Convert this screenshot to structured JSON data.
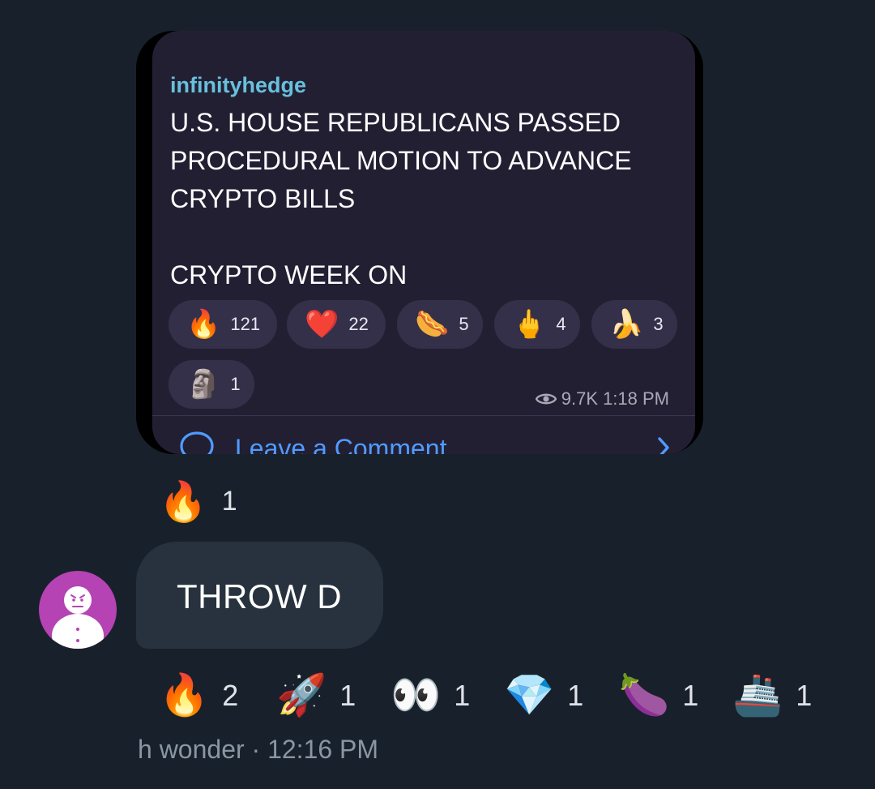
{
  "card": {
    "channel": "infinityhedge",
    "lines": [
      "U.S. HOUSE REPUBLICANS PASSED",
      "PROCEDURAL MOTION TO ADVANCE",
      "CRYPTO BILLS",
      "",
      "CRYPTO WEEK ON"
    ],
    "reactions": [
      {
        "emoji": "🔥",
        "count": "121"
      },
      {
        "emoji": "❤️",
        "count": "22"
      },
      {
        "emoji": "🌭",
        "count": "5"
      },
      {
        "emoji": "🖕",
        "count": "4"
      },
      {
        "emoji": "🍌",
        "count": "3"
      },
      {
        "emoji": "🗿",
        "count": "1"
      }
    ],
    "views": "9.7K",
    "time": "1:18 PM",
    "comment_label": "Leave a Comment"
  },
  "card_reaction": {
    "emoji": "🔥",
    "count": "1"
  },
  "message": {
    "text": "THROW D",
    "reactions": [
      {
        "emoji": "🔥",
        "count": "2"
      },
      {
        "emoji": "🚀",
        "count": "1"
      },
      {
        "emoji": "👀",
        "count": "1"
      },
      {
        "emoji": "💎",
        "count": "1"
      },
      {
        "emoji": "🍆",
        "count": "1"
      },
      {
        "emoji": "🚢",
        "count": "1"
      }
    ],
    "sender": "h wonder",
    "separator": "·",
    "time": "12:16 PM"
  },
  "colors": {
    "background": "#18212b",
    "card": "#231f33",
    "channel_name": "#68c0dc",
    "link": "#4f9cff",
    "bubble": "#27323e",
    "avatar": "#b543b3"
  }
}
